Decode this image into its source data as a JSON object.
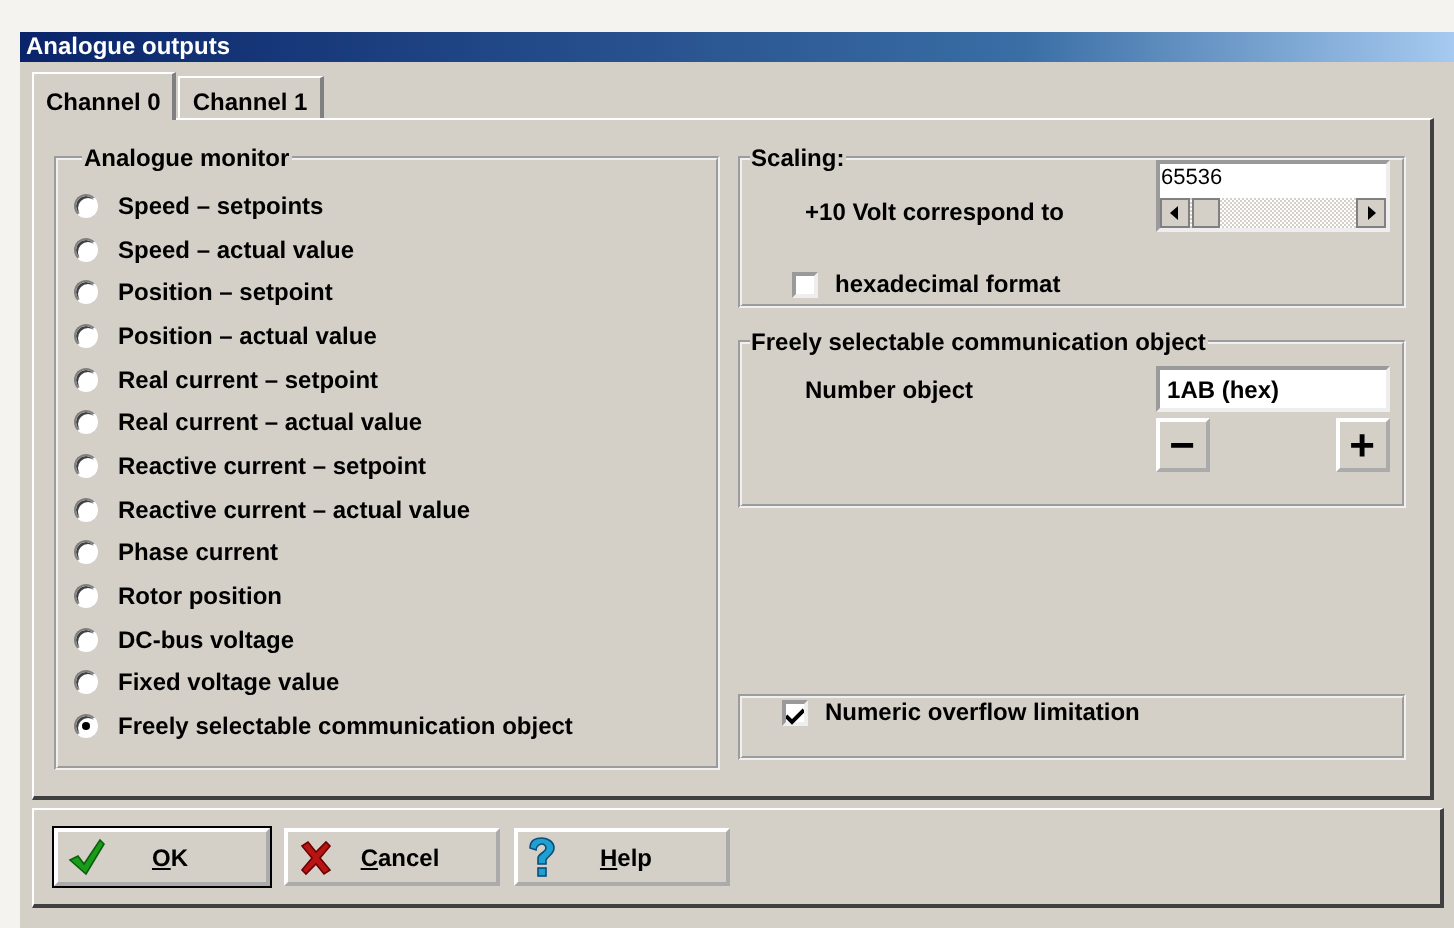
{
  "window": {
    "title": "Analogue outputs"
  },
  "tabs": [
    {
      "label": "Channel 0",
      "selected": true
    },
    {
      "label": "Channel 1",
      "selected": false
    }
  ],
  "analogue_monitor": {
    "title": "Analogue monitor",
    "options": [
      {
        "label": "Speed – setpoints",
        "selected": false
      },
      {
        "label": "Speed – actual value",
        "selected": false
      },
      {
        "label": "Position – setpoint",
        "selected": false
      },
      {
        "label": "Position – actual value",
        "selected": false
      },
      {
        "label": "Real current – setpoint",
        "selected": false
      },
      {
        "label": "Real current – actual value",
        "selected": false
      },
      {
        "label": "Reactive current – setpoint",
        "selected": false
      },
      {
        "label": "Reactive current – actual value",
        "selected": false
      },
      {
        "label": "Phase current",
        "selected": false
      },
      {
        "label": "Rotor position",
        "selected": false
      },
      {
        "label": "DC-bus voltage",
        "selected": false
      },
      {
        "label": "Fixed voltage value",
        "selected": false
      },
      {
        "label": "Freely selectable communication object",
        "selected": true
      }
    ]
  },
  "scaling": {
    "title": "Scaling:",
    "label": "+10 Volt correspond to",
    "value": "65536",
    "hexadecimal": {
      "label": "hexadecimal format",
      "checked": false
    }
  },
  "communication_object": {
    "title": "Freely selectable communication object",
    "label": "Number object",
    "value": "1AB (hex)",
    "decrement": "−",
    "increment": "+"
  },
  "overflow": {
    "label": "Numeric overflow limitation",
    "checked": true
  },
  "buttons": [
    {
      "label": "OK",
      "kind": "ok"
    },
    {
      "label": "Cancel",
      "kind": "cancel"
    },
    {
      "label": "Help",
      "kind": "help"
    }
  ]
}
